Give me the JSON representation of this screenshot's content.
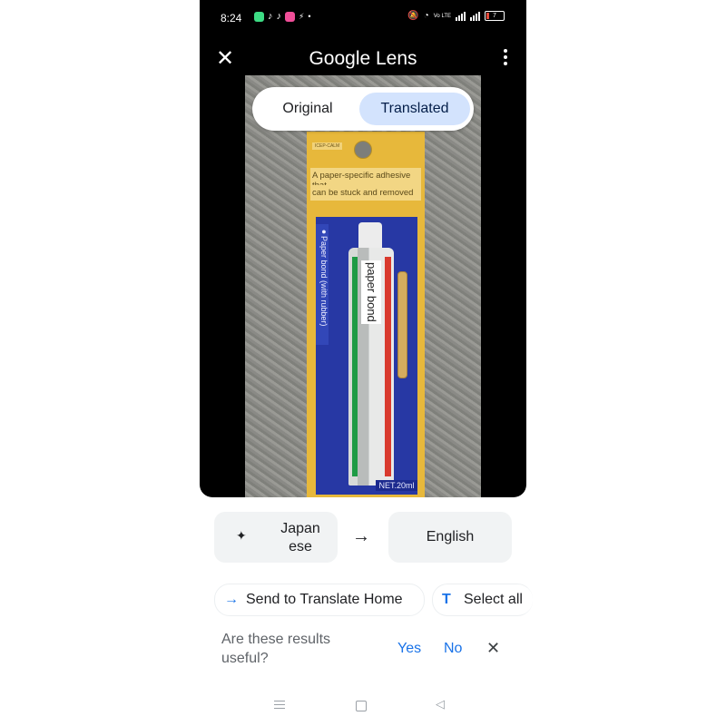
{
  "status_bar": {
    "time": "8:24",
    "battery": "7",
    "network": "Vo LTE"
  },
  "app_bar": {
    "title": "Google Lens",
    "close_icon": "close-icon",
    "more_icon": "more-vert-icon"
  },
  "view_toggle": {
    "original_label": "Original",
    "translated_label": "Translated",
    "selected": "Translated"
  },
  "photo": {
    "card_tag": "ICEP-CALM",
    "card_line1": "A paper-specific adhesive that",
    "card_line2": "can be stuck and removed",
    "side_label": "●Paper bond (with rubber)",
    "tube_label": "paper bond",
    "net": "NET.20ml"
  },
  "languages": {
    "source": "Japanese",
    "target": "English",
    "swap_icon": "arrow-right-icon",
    "source_icon": "sparkle-icon"
  },
  "actions": {
    "send_label": "Send to Translate Home",
    "select_all_label": "Select all"
  },
  "feedback": {
    "question": "Are these results useful?",
    "yes": "Yes",
    "no": "No"
  },
  "colors": {
    "accent": "#1a73e8",
    "selected_chip": "#d3e3fd",
    "button_bg": "#f1f3f4"
  }
}
